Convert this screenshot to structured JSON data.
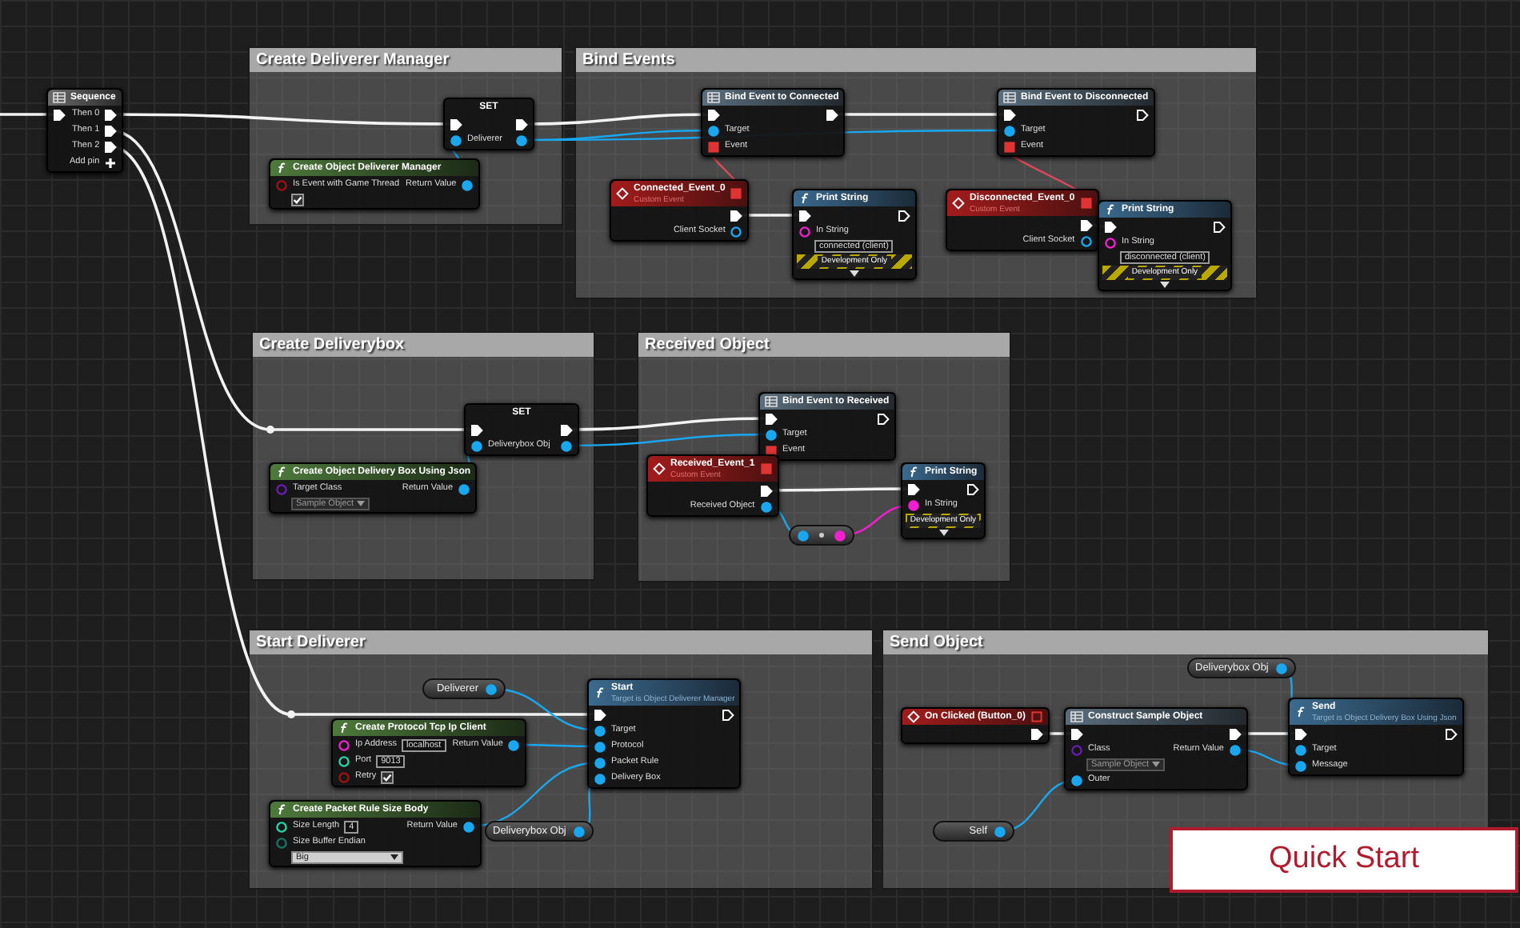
{
  "comments": [
    {
      "title": "Create Deliverer Manager"
    },
    {
      "title": "Bind Events"
    },
    {
      "title": "Create Deliverybox"
    },
    {
      "title": "Received Object"
    },
    {
      "title": "Start Deliverer"
    },
    {
      "title": "Send Object"
    }
  ],
  "nodes": [
    {
      "kind": "sequence",
      "title": "Sequence",
      "rows": [
        {
          "in": {
            "kind": "exec",
            "linked": true
          },
          "out": {
            "kind": "exec",
            "label": "Then 0",
            "linked": true
          }
        },
        {
          "out": {
            "kind": "exec",
            "label": "Then 1",
            "linked": true
          }
        },
        {
          "out": {
            "kind": "exec",
            "label": "Then 2",
            "linked": true
          }
        },
        {
          "out": {
            "kind": "add",
            "label": "Add pin"
          }
        }
      ]
    },
    {
      "kind": "set",
      "title": "SET",
      "rows": [
        {
          "in": {
            "kind": "exec",
            "linked": true
          },
          "out": {
            "kind": "exec",
            "linked": true
          }
        },
        {
          "in": {
            "kind": "object",
            "label": "Deliverer",
            "linked": true
          },
          "out": {
            "kind": "object",
            "linked": true
          }
        }
      ]
    },
    {
      "kind": "pure",
      "title": "Create Object Deliverer Manager",
      "rows": [
        {
          "in": {
            "kind": "bool",
            "label": "Is Event with Game Thread",
            "linked": false,
            "checked": true
          },
          "out": {
            "kind": "object",
            "label": "Return Value",
            "linked": true
          }
        }
      ]
    },
    {
      "kind": "bind",
      "title": "Bind Event to Connected",
      "rows": [
        {
          "in": {
            "kind": "exec",
            "linked": true
          },
          "out": {
            "kind": "exec",
            "linked": true
          }
        },
        {
          "in": {
            "kind": "object",
            "label": "Target",
            "linked": true
          }
        },
        {
          "in": {
            "kind": "delegate",
            "label": "Event",
            "linked": true
          }
        }
      ]
    },
    {
      "kind": "bind",
      "title": "Bind Event to Disconnected",
      "rows": [
        {
          "in": {
            "kind": "exec",
            "linked": true
          },
          "out": {
            "kind": "exec",
            "linked": false
          }
        },
        {
          "in": {
            "kind": "object",
            "label": "Target",
            "linked": true
          }
        },
        {
          "in": {
            "kind": "delegate",
            "label": "Event",
            "linked": true
          }
        }
      ]
    },
    {
      "kind": "event",
      "title": "Connected_Event_0",
      "subtitle": "Custom Event",
      "header_pin": {
        "kind": "delegate",
        "linked": true
      },
      "rows": [
        {
          "out": {
            "kind": "exec",
            "linked": true
          }
        },
        {
          "out": {
            "kind": "object",
            "label": "Client Socket",
            "linked": false
          }
        }
      ]
    },
    {
      "kind": "call",
      "title": "Print String",
      "footer": "Development Only",
      "rows": [
        {
          "in": {
            "kind": "exec",
            "linked": true
          },
          "out": {
            "kind": "exec",
            "linked": false
          }
        },
        {
          "in": {
            "kind": "string",
            "label": "In String",
            "linked": false,
            "value": "connected (client)"
          }
        }
      ]
    },
    {
      "kind": "event",
      "title": "Disconnected_Event_0",
      "subtitle": "Custom Event",
      "header_pin": {
        "kind": "delegate",
        "linked": true
      },
      "rows": [
        {
          "out": {
            "kind": "exec",
            "linked": true
          }
        },
        {
          "out": {
            "kind": "object",
            "label": "Client Socket",
            "linked": false
          }
        }
      ]
    },
    {
      "kind": "call",
      "title": "Print String",
      "footer": "Development Only",
      "rows": [
        {
          "in": {
            "kind": "exec",
            "linked": true
          },
          "out": {
            "kind": "exec",
            "linked": false
          }
        },
        {
          "in": {
            "kind": "string",
            "label": "In String",
            "linked": false,
            "value": "disconnected (client)"
          }
        }
      ]
    },
    {
      "kind": "set",
      "title": "SET",
      "rows": [
        {
          "in": {
            "kind": "exec",
            "linked": true
          },
          "out": {
            "kind": "exec",
            "linked": true
          }
        },
        {
          "in": {
            "kind": "object",
            "label": "Deliverybox Obj",
            "linked": true
          },
          "out": {
            "kind": "object",
            "linked": true
          }
        }
      ]
    },
    {
      "kind": "pure",
      "title": "Create Object Delivery Box Using Json",
      "rows": [
        {
          "in": {
            "kind": "class",
            "label": "Target Class",
            "linked": false,
            "value": "Sample Object"
          },
          "out": {
            "kind": "object",
            "label": "Return Value",
            "linked": true
          }
        }
      ]
    },
    {
      "kind": "bind",
      "title": "Bind Event to Received",
      "rows": [
        {
          "in": {
            "kind": "exec",
            "linked": true
          },
          "out": {
            "kind": "exec",
            "linked": false
          }
        },
        {
          "in": {
            "kind": "object",
            "label": "Target",
            "linked": true
          }
        },
        {
          "in": {
            "kind": "delegate",
            "label": "Event",
            "linked": true
          }
        }
      ]
    },
    {
      "kind": "event",
      "title": "Received_Event_1",
      "subtitle": "Custom Event",
      "header_pin": {
        "kind": "delegate",
        "linked": true
      },
      "rows": [
        {
          "out": {
            "kind": "exec",
            "linked": true
          }
        },
        {
          "out": {
            "kind": "object",
            "label": "Received Object",
            "linked": true
          }
        }
      ]
    },
    {
      "kind": "call",
      "title": "Print String",
      "footer": "Development Only",
      "rows": [
        {
          "in": {
            "kind": "exec",
            "linked": true
          },
          "out": {
            "kind": "exec",
            "linked": false
          }
        },
        {
          "in": {
            "kind": "string",
            "label": "In String",
            "linked": true
          }
        }
      ]
    },
    {
      "kind": "convert",
      "rows": [
        {
          "in": {
            "kind": "object",
            "linked": true
          },
          "out": {
            "kind": "string",
            "linked": true
          }
        }
      ]
    },
    {
      "kind": "variable",
      "title": "Deliverer",
      "rows": [
        {
          "out": {
            "kind": "object",
            "linked": true
          }
        }
      ]
    },
    {
      "kind": "pure",
      "title": "Create Protocol Tcp Ip Client",
      "rows": [
        {
          "in": {
            "kind": "string",
            "label": "Ip Address",
            "linked": false,
            "value": "localhost"
          },
          "out": {
            "kind": "object",
            "label": "Return Value",
            "linked": true
          }
        },
        {
          "in": {
            "kind": "int",
            "label": "Port",
            "linked": false,
            "value": "9013"
          }
        },
        {
          "in": {
            "kind": "bool",
            "label": "Retry",
            "linked": false,
            "checked": true
          }
        }
      ]
    },
    {
      "kind": "pure",
      "title": "Create Packet Rule Size Body",
      "rows": [
        {
          "in": {
            "kind": "int",
            "label": "Size Length",
            "linked": false,
            "value": "4"
          },
          "out": {
            "kind": "object",
            "label": "Return Value",
            "linked": true
          }
        },
        {
          "in": {
            "kind": "enum",
            "label": "Size Buffer Endian",
            "linked": false,
            "value": "Big"
          }
        }
      ]
    },
    {
      "kind": "variable",
      "title": "Deliverybox Obj",
      "rows": [
        {
          "out": {
            "kind": "object",
            "linked": true
          }
        }
      ]
    },
    {
      "kind": "call",
      "title": "Start",
      "subtitle": "Target is Object Deliverer Manager",
      "rows": [
        {
          "in": {
            "kind": "exec",
            "linked": true
          },
          "out": {
            "kind": "exec",
            "linked": false
          }
        },
        {
          "in": {
            "kind": "object",
            "label": "Target",
            "linked": true
          }
        },
        {
          "in": {
            "kind": "object",
            "label": "Protocol",
            "linked": true
          }
        },
        {
          "in": {
            "kind": "object",
            "label": "Packet Rule",
            "linked": true
          }
        },
        {
          "in": {
            "kind": "object",
            "label": "Delivery Box",
            "linked": true
          }
        }
      ]
    },
    {
      "kind": "variable",
      "title": "Deliverybox Obj",
      "rows": [
        {
          "out": {
            "kind": "object",
            "linked": true
          }
        }
      ]
    },
    {
      "kind": "event",
      "title": "On Clicked (Button_0)",
      "header_pin": {
        "kind": "delegate",
        "linked": false
      },
      "rows": [
        {
          "out": {
            "kind": "exec",
            "linked": true
          }
        }
      ]
    },
    {
      "kind": "construct",
      "title": "Construct Sample Object",
      "rows": [
        {
          "in": {
            "kind": "exec",
            "linked": true
          },
          "out": {
            "kind": "exec",
            "linked": true
          }
        },
        {
          "in": {
            "kind": "class",
            "label": "Class",
            "linked": false,
            "value": "Sample Object"
          },
          "out": {
            "kind": "object",
            "label": "Return Value",
            "linked": true
          }
        },
        {
          "in": {
            "kind": "object",
            "label": "Outer",
            "linked": true
          }
        }
      ]
    },
    {
      "kind": "call",
      "title": "Send",
      "subtitle": "Target is Object Delivery Box Using Json",
      "rows": [
        {
          "in": {
            "kind": "exec",
            "linked": true
          },
          "out": {
            "kind": "exec",
            "linked": false
          }
        },
        {
          "in": {
            "kind": "object",
            "label": "Target",
            "linked": true
          }
        },
        {
          "in": {
            "kind": "object",
            "label": "Message",
            "linked": true
          }
        }
      ]
    },
    {
      "kind": "variable",
      "title": "Self",
      "rows": [
        {
          "out": {
            "kind": "object",
            "linked": true
          }
        }
      ]
    }
  ],
  "banner": {
    "text": "Quick Start"
  }
}
